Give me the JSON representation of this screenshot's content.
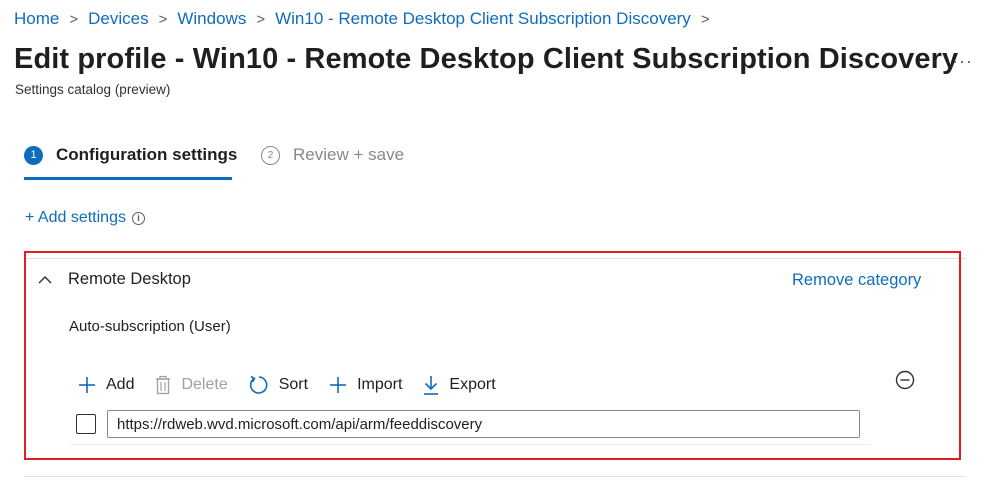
{
  "breadcrumb": {
    "items": [
      "Home",
      "Devices",
      "Windows",
      "Win10 - Remote Desktop Client Subscription Discovery"
    ],
    "separator": ">"
  },
  "page": {
    "title": "Edit profile - Win10 - Remote Desktop Client Subscription Discovery",
    "subtitle": "Settings catalog (preview)",
    "more_label": "···"
  },
  "wizard": {
    "steps": [
      {
        "number": "1",
        "label": "Configuration settings",
        "active": true
      },
      {
        "number": "2",
        "label": "Review + save",
        "active": false
      }
    ]
  },
  "add_settings": {
    "label": "+ Add settings",
    "info_icon": "i"
  },
  "category": {
    "title": "Remote Desktop",
    "remove_label": "Remove category",
    "setting_label": "Auto-subscription (User)",
    "toolbar": {
      "add": "Add",
      "delete": "Delete",
      "sort": "Sort",
      "import": "Import",
      "export": "Export"
    },
    "entries": [
      {
        "value": "https://rdweb.wvd.microsoft.com/api/arm/feeddiscovery",
        "checked": false
      }
    ]
  },
  "colors": {
    "accent": "#0f6cbd",
    "highlight_border": "#e02020",
    "disabled": "#a19f9d"
  },
  "icons": [
    "chevron-right-icon",
    "more-icon",
    "info-icon",
    "chevron-up-icon",
    "plus-icon",
    "trash-icon",
    "refresh-icon",
    "download-icon",
    "minus-circle-icon"
  ]
}
